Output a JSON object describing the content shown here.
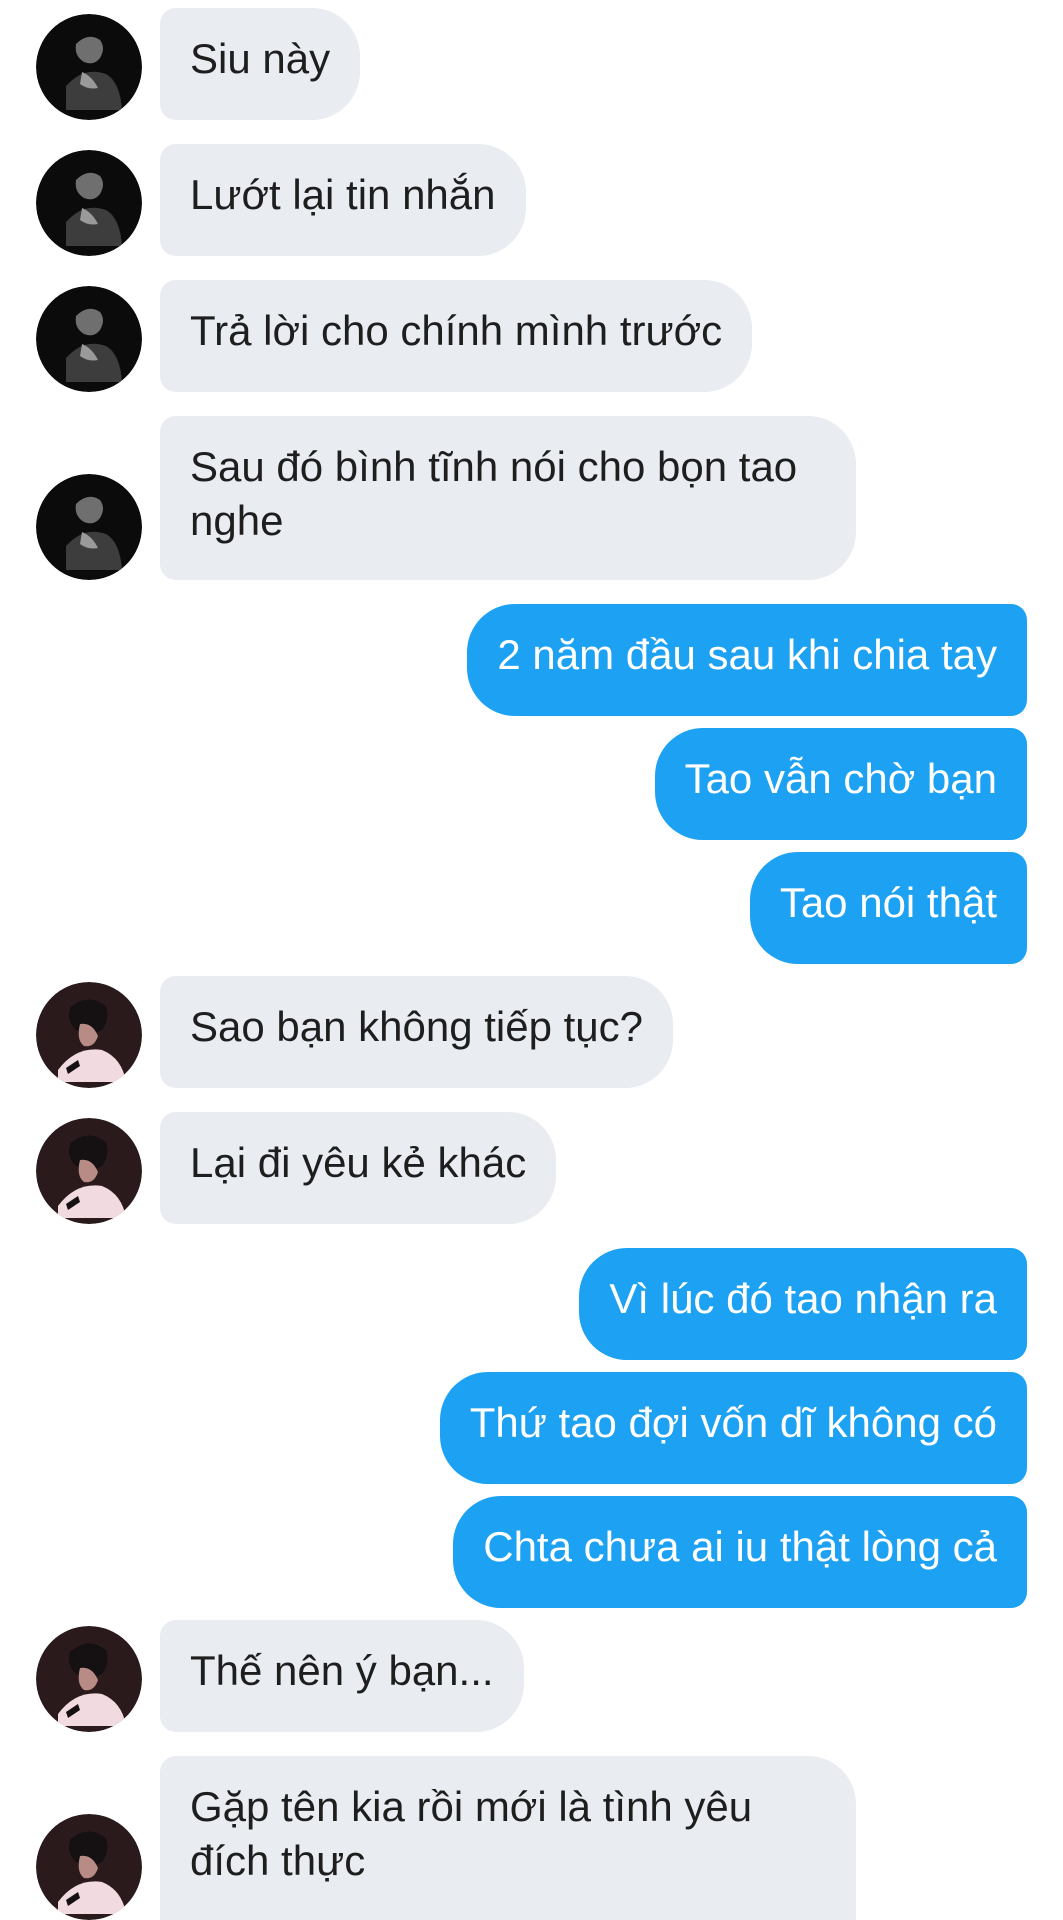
{
  "conversation": {
    "messages": [
      {
        "sender": "them",
        "avatar": "avatar-dark",
        "text": "Siu này"
      },
      {
        "sender": "them",
        "avatar": "avatar-dark",
        "text": "Lướt lại tin nhắn"
      },
      {
        "sender": "them",
        "avatar": "avatar-dark",
        "text": "Trả lời cho chính mình trước"
      },
      {
        "sender": "them",
        "avatar": "avatar-dark",
        "text": "Sau đó bình tĩnh nói cho bọn tao nghe"
      },
      {
        "sender": "me",
        "text": "2 năm đầu sau khi chia tay"
      },
      {
        "sender": "me",
        "text": "Tao vẫn chờ bạn"
      },
      {
        "sender": "me",
        "text": "Tao nói thật"
      },
      {
        "sender": "them",
        "avatar": "avatar-pink",
        "text": "Sao bạn không tiếp tục?"
      },
      {
        "sender": "them",
        "avatar": "avatar-pink",
        "text": "Lại đi yêu kẻ khác"
      },
      {
        "sender": "me",
        "text": "Vì lúc đó tao nhận ra"
      },
      {
        "sender": "me",
        "text": "Thứ tao đợi vốn dĩ không có"
      },
      {
        "sender": "me",
        "text": "Chta chưa ai iu thật lòng cả"
      },
      {
        "sender": "them",
        "avatar": "avatar-pink",
        "text": "Thế nên ý bạn..."
      },
      {
        "sender": "them",
        "avatar": "avatar-pink",
        "text": "Gặp tên kia rồi mới là tình yêu đích thực"
      }
    ]
  },
  "colors": {
    "incoming_bubble": "#e9ecf0",
    "outgoing_bubble": "#1da1f2",
    "incoming_text": "#1e1e1e",
    "outgoing_text": "#ffffff"
  }
}
